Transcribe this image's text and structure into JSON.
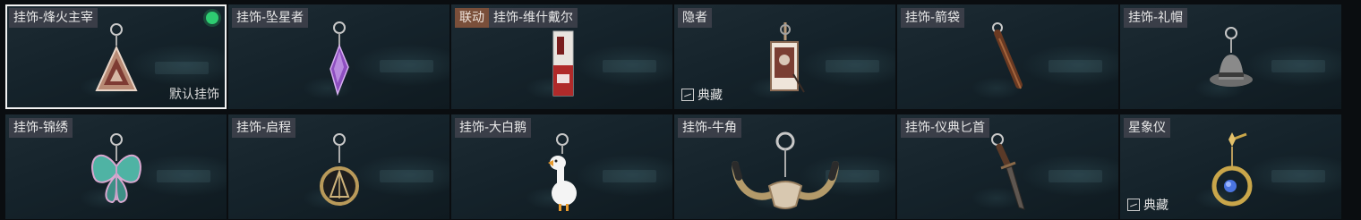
{
  "cards": [
    {
      "collab": "",
      "name": "挂饰-烽火主宰",
      "badge": "默认挂饰",
      "rarity": "",
      "selected": true
    },
    {
      "collab": "",
      "name": "挂饰-坠星者",
      "badge": "",
      "rarity": ""
    },
    {
      "collab": "联动",
      "name": "挂饰-维什戴尔",
      "badge": "",
      "rarity": ""
    },
    {
      "collab": "",
      "name": "隐者",
      "badge": "",
      "rarity": "典藏"
    },
    {
      "collab": "",
      "name": "挂饰-箭袋",
      "badge": "",
      "rarity": ""
    },
    {
      "collab": "",
      "name": "挂饰-礼帽",
      "badge": "",
      "rarity": ""
    },
    {
      "collab": "",
      "name": "挂饰-锦绣",
      "badge": "",
      "rarity": ""
    },
    {
      "collab": "",
      "name": "挂饰-启程",
      "badge": "",
      "rarity": ""
    },
    {
      "collab": "",
      "name": "挂饰-大白鹅",
      "badge": "",
      "rarity": ""
    },
    {
      "collab": "",
      "name": "挂饰-牛角",
      "badge": "",
      "rarity": ""
    },
    {
      "collab": "",
      "name": "挂饰-仪典匕首",
      "badge": "",
      "rarity": ""
    },
    {
      "collab": "",
      "name": "星象仪",
      "badge": "",
      "rarity": "典藏"
    }
  ],
  "icons": [
    "pyramid-charm-icon",
    "crystal-charm-icon",
    "card-charm-icon",
    "tarot-charm-icon",
    "quiver-charm-icon",
    "hat-charm-icon",
    "butterfly-charm-icon",
    "compass-charm-icon",
    "goose-charm-icon",
    "horn-charm-icon",
    "dagger-charm-icon",
    "astrolabe-charm-icon"
  ],
  "colors": {
    "selected_dot": "#2ecc71",
    "collab_bg": "#7a4f3a"
  }
}
